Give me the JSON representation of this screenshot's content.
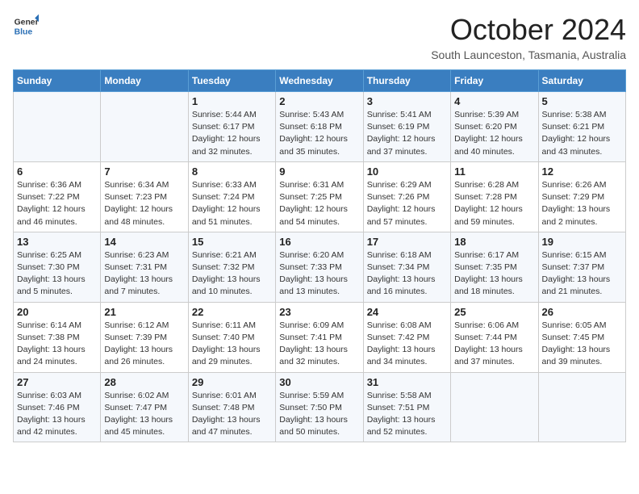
{
  "header": {
    "logo_line1": "General",
    "logo_line2": "Blue",
    "month_title": "October 2024",
    "location": "South Launceston, Tasmania, Australia"
  },
  "days_of_week": [
    "Sunday",
    "Monday",
    "Tuesday",
    "Wednesday",
    "Thursday",
    "Friday",
    "Saturday"
  ],
  "weeks": [
    [
      {
        "day": "",
        "sunrise": "",
        "sunset": "",
        "daylight": ""
      },
      {
        "day": "",
        "sunrise": "",
        "sunset": "",
        "daylight": ""
      },
      {
        "day": "1",
        "sunrise": "Sunrise: 5:44 AM",
        "sunset": "Sunset: 6:17 PM",
        "daylight": "Daylight: 12 hours and 32 minutes."
      },
      {
        "day": "2",
        "sunrise": "Sunrise: 5:43 AM",
        "sunset": "Sunset: 6:18 PM",
        "daylight": "Daylight: 12 hours and 35 minutes."
      },
      {
        "day": "3",
        "sunrise": "Sunrise: 5:41 AM",
        "sunset": "Sunset: 6:19 PM",
        "daylight": "Daylight: 12 hours and 37 minutes."
      },
      {
        "day": "4",
        "sunrise": "Sunrise: 5:39 AM",
        "sunset": "Sunset: 6:20 PM",
        "daylight": "Daylight: 12 hours and 40 minutes."
      },
      {
        "day": "5",
        "sunrise": "Sunrise: 5:38 AM",
        "sunset": "Sunset: 6:21 PM",
        "daylight": "Daylight: 12 hours and 43 minutes."
      }
    ],
    [
      {
        "day": "6",
        "sunrise": "Sunrise: 6:36 AM",
        "sunset": "Sunset: 7:22 PM",
        "daylight": "Daylight: 12 hours and 46 minutes."
      },
      {
        "day": "7",
        "sunrise": "Sunrise: 6:34 AM",
        "sunset": "Sunset: 7:23 PM",
        "daylight": "Daylight: 12 hours and 48 minutes."
      },
      {
        "day": "8",
        "sunrise": "Sunrise: 6:33 AM",
        "sunset": "Sunset: 7:24 PM",
        "daylight": "Daylight: 12 hours and 51 minutes."
      },
      {
        "day": "9",
        "sunrise": "Sunrise: 6:31 AM",
        "sunset": "Sunset: 7:25 PM",
        "daylight": "Daylight: 12 hours and 54 minutes."
      },
      {
        "day": "10",
        "sunrise": "Sunrise: 6:29 AM",
        "sunset": "Sunset: 7:26 PM",
        "daylight": "Daylight: 12 hours and 57 minutes."
      },
      {
        "day": "11",
        "sunrise": "Sunrise: 6:28 AM",
        "sunset": "Sunset: 7:28 PM",
        "daylight": "Daylight: 12 hours and 59 minutes."
      },
      {
        "day": "12",
        "sunrise": "Sunrise: 6:26 AM",
        "sunset": "Sunset: 7:29 PM",
        "daylight": "Daylight: 13 hours and 2 minutes."
      }
    ],
    [
      {
        "day": "13",
        "sunrise": "Sunrise: 6:25 AM",
        "sunset": "Sunset: 7:30 PM",
        "daylight": "Daylight: 13 hours and 5 minutes."
      },
      {
        "day": "14",
        "sunrise": "Sunrise: 6:23 AM",
        "sunset": "Sunset: 7:31 PM",
        "daylight": "Daylight: 13 hours and 7 minutes."
      },
      {
        "day": "15",
        "sunrise": "Sunrise: 6:21 AM",
        "sunset": "Sunset: 7:32 PM",
        "daylight": "Daylight: 13 hours and 10 minutes."
      },
      {
        "day": "16",
        "sunrise": "Sunrise: 6:20 AM",
        "sunset": "Sunset: 7:33 PM",
        "daylight": "Daylight: 13 hours and 13 minutes."
      },
      {
        "day": "17",
        "sunrise": "Sunrise: 6:18 AM",
        "sunset": "Sunset: 7:34 PM",
        "daylight": "Daylight: 13 hours and 16 minutes."
      },
      {
        "day": "18",
        "sunrise": "Sunrise: 6:17 AM",
        "sunset": "Sunset: 7:35 PM",
        "daylight": "Daylight: 13 hours and 18 minutes."
      },
      {
        "day": "19",
        "sunrise": "Sunrise: 6:15 AM",
        "sunset": "Sunset: 7:37 PM",
        "daylight": "Daylight: 13 hours and 21 minutes."
      }
    ],
    [
      {
        "day": "20",
        "sunrise": "Sunrise: 6:14 AM",
        "sunset": "Sunset: 7:38 PM",
        "daylight": "Daylight: 13 hours and 24 minutes."
      },
      {
        "day": "21",
        "sunrise": "Sunrise: 6:12 AM",
        "sunset": "Sunset: 7:39 PM",
        "daylight": "Daylight: 13 hours and 26 minutes."
      },
      {
        "day": "22",
        "sunrise": "Sunrise: 6:11 AM",
        "sunset": "Sunset: 7:40 PM",
        "daylight": "Daylight: 13 hours and 29 minutes."
      },
      {
        "day": "23",
        "sunrise": "Sunrise: 6:09 AM",
        "sunset": "Sunset: 7:41 PM",
        "daylight": "Daylight: 13 hours and 32 minutes."
      },
      {
        "day": "24",
        "sunrise": "Sunrise: 6:08 AM",
        "sunset": "Sunset: 7:42 PM",
        "daylight": "Daylight: 13 hours and 34 minutes."
      },
      {
        "day": "25",
        "sunrise": "Sunrise: 6:06 AM",
        "sunset": "Sunset: 7:44 PM",
        "daylight": "Daylight: 13 hours and 37 minutes."
      },
      {
        "day": "26",
        "sunrise": "Sunrise: 6:05 AM",
        "sunset": "Sunset: 7:45 PM",
        "daylight": "Daylight: 13 hours and 39 minutes."
      }
    ],
    [
      {
        "day": "27",
        "sunrise": "Sunrise: 6:03 AM",
        "sunset": "Sunset: 7:46 PM",
        "daylight": "Daylight: 13 hours and 42 minutes."
      },
      {
        "day": "28",
        "sunrise": "Sunrise: 6:02 AM",
        "sunset": "Sunset: 7:47 PM",
        "daylight": "Daylight: 13 hours and 45 minutes."
      },
      {
        "day": "29",
        "sunrise": "Sunrise: 6:01 AM",
        "sunset": "Sunset: 7:48 PM",
        "daylight": "Daylight: 13 hours and 47 minutes."
      },
      {
        "day": "30",
        "sunrise": "Sunrise: 5:59 AM",
        "sunset": "Sunset: 7:50 PM",
        "daylight": "Daylight: 13 hours and 50 minutes."
      },
      {
        "day": "31",
        "sunrise": "Sunrise: 5:58 AM",
        "sunset": "Sunset: 7:51 PM",
        "daylight": "Daylight: 13 hours and 52 minutes."
      },
      {
        "day": "",
        "sunrise": "",
        "sunset": "",
        "daylight": ""
      },
      {
        "day": "",
        "sunrise": "",
        "sunset": "",
        "daylight": ""
      }
    ]
  ]
}
